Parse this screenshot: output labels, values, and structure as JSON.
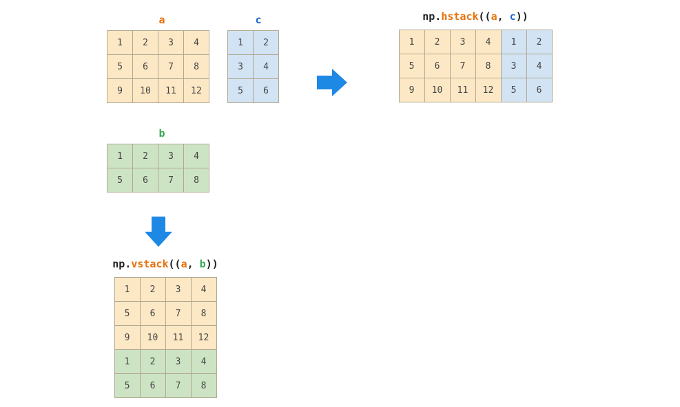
{
  "colors": {
    "orange": "#E8710A",
    "blue": "#1967D2",
    "green": "#34A853",
    "arrow": "#1E88E5"
  },
  "labels": {
    "a": "a",
    "b": "b",
    "c": "c"
  },
  "expr": {
    "hstack": {
      "np": "np.",
      "fn": "hstack",
      "open": "((",
      "arg1": "a",
      "comma": ", ",
      "arg2": "c",
      "close": "))"
    },
    "vstack": {
      "np": "np.",
      "fn": "vstack",
      "open": "((",
      "arg1": "a",
      "comma": ", ",
      "arg2": "b",
      "close": "))"
    }
  },
  "chart_data": {
    "type": "table",
    "a": {
      "rows": [
        [
          1,
          2,
          3,
          4
        ],
        [
          5,
          6,
          7,
          8
        ],
        [
          9,
          10,
          11,
          12
        ]
      ],
      "fill": "orange"
    },
    "c": {
      "rows": [
        [
          1,
          2
        ],
        [
          3,
          4
        ],
        [
          5,
          6
        ]
      ],
      "fill": "blue"
    },
    "b": {
      "rows": [
        [
          1,
          2,
          3,
          4
        ],
        [
          5,
          6,
          7,
          8
        ]
      ],
      "fill": "green"
    },
    "hstack_result": {
      "rows": [
        [
          {
            "v": 1,
            "fill": "orange"
          },
          {
            "v": 2,
            "fill": "orange"
          },
          {
            "v": 3,
            "fill": "orange"
          },
          {
            "v": 4,
            "fill": "orange"
          },
          {
            "v": 1,
            "fill": "blue"
          },
          {
            "v": 2,
            "fill": "blue"
          }
        ],
        [
          {
            "v": 5,
            "fill": "orange"
          },
          {
            "v": 6,
            "fill": "orange"
          },
          {
            "v": 7,
            "fill": "orange"
          },
          {
            "v": 8,
            "fill": "orange"
          },
          {
            "v": 3,
            "fill": "blue"
          },
          {
            "v": 4,
            "fill": "blue"
          }
        ],
        [
          {
            "v": 9,
            "fill": "orange"
          },
          {
            "v": 10,
            "fill": "orange"
          },
          {
            "v": 11,
            "fill": "orange"
          },
          {
            "v": 12,
            "fill": "orange"
          },
          {
            "v": 5,
            "fill": "blue"
          },
          {
            "v": 6,
            "fill": "blue"
          }
        ]
      ]
    },
    "vstack_result": {
      "rows": [
        [
          {
            "v": 1,
            "fill": "orange"
          },
          {
            "v": 2,
            "fill": "orange"
          },
          {
            "v": 3,
            "fill": "orange"
          },
          {
            "v": 4,
            "fill": "orange"
          }
        ],
        [
          {
            "v": 5,
            "fill": "orange"
          },
          {
            "v": 6,
            "fill": "orange"
          },
          {
            "v": 7,
            "fill": "orange"
          },
          {
            "v": 8,
            "fill": "orange"
          }
        ],
        [
          {
            "v": 9,
            "fill": "orange"
          },
          {
            "v": 10,
            "fill": "orange"
          },
          {
            "v": 11,
            "fill": "orange"
          },
          {
            "v": 12,
            "fill": "orange"
          }
        ],
        [
          {
            "v": 1,
            "fill": "green"
          },
          {
            "v": 2,
            "fill": "green"
          },
          {
            "v": 3,
            "fill": "green"
          },
          {
            "v": 4,
            "fill": "green"
          }
        ],
        [
          {
            "v": 5,
            "fill": "green"
          },
          {
            "v": 6,
            "fill": "green"
          },
          {
            "v": 7,
            "fill": "green"
          },
          {
            "v": 8,
            "fill": "green"
          }
        ]
      ]
    }
  }
}
